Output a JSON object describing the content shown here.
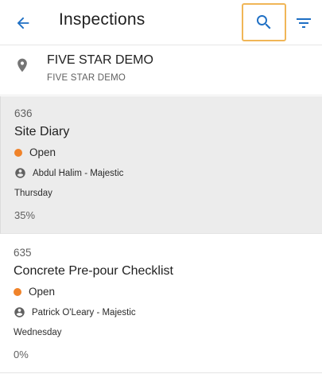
{
  "appbar": {
    "title": "Inspections",
    "back_icon": "arrow-back-icon",
    "search_icon": "search-icon",
    "filter_icon": "filter-list-icon",
    "accent_color": "#1e6fc4",
    "highlight_color": "#f0b657"
  },
  "project": {
    "icon": "location-pin-icon",
    "name": "FIVE STAR DEMO",
    "subtitle": "FIVE STAR DEMO"
  },
  "inspections": [
    {
      "number": "636",
      "name": "Site Diary",
      "status": "Open",
      "status_color": "#f0832a",
      "person": "Abdul Halim - Majestic",
      "day": "Thursday",
      "progress": "35%",
      "selected": true
    },
    {
      "number": "635",
      "name": "Concrete Pre-pour Checklist",
      "status": "Open",
      "status_color": "#f0832a",
      "person": "Patrick O'Leary - Majestic",
      "day": "Wednesday",
      "progress": "0%",
      "selected": false
    }
  ]
}
